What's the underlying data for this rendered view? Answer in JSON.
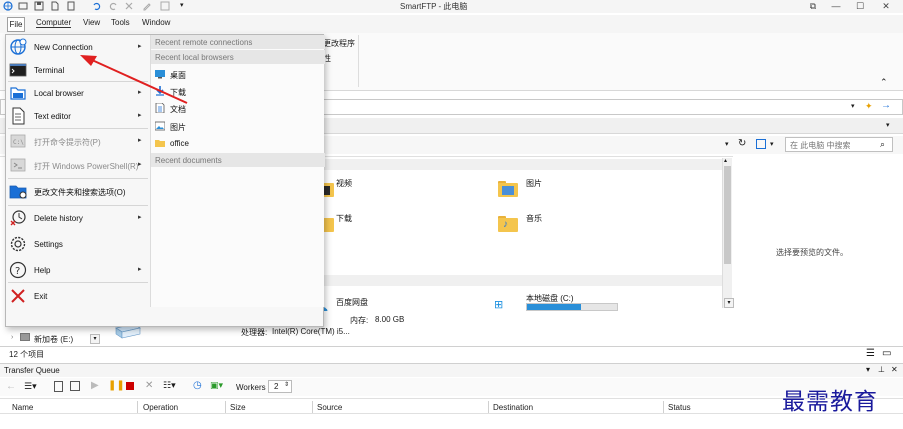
{
  "window": {
    "title": "SmartFTP - 此电脑"
  },
  "menubar": {
    "file": "File",
    "computer": "Computer",
    "view": "View",
    "tools": "Tools",
    "window": "Window"
  },
  "ribbon": {
    "fragment_1": "更改程序",
    "fragment_2": "性"
  },
  "search": {
    "placeholder": "在 此电脑 中搜索"
  },
  "file_menu": {
    "items": [
      {
        "label": "New Connection",
        "icon": "globe-icon",
        "submenu": true
      },
      {
        "label": "Terminal",
        "icon": "terminal-icon",
        "submenu": false
      },
      {
        "label": "Local browser",
        "icon": "local-browser-icon",
        "submenu": true
      },
      {
        "label": "Text editor",
        "icon": "text-editor-icon",
        "submenu": true
      },
      {
        "label": "打开命令提示符(P)",
        "icon": "cmd-icon",
        "submenu": true,
        "disabled": true
      },
      {
        "label": "打开 Windows PowerShell(R)",
        "icon": "powershell-icon",
        "submenu": true,
        "disabled": true
      },
      {
        "label": "更改文件夹和搜索选项(O)",
        "icon": "folder-options-icon",
        "submenu": false
      },
      {
        "label": "Delete history",
        "icon": "history-icon",
        "submenu": true
      },
      {
        "label": "Settings",
        "icon": "gear-icon",
        "submenu": false
      },
      {
        "label": "Help",
        "icon": "help-icon",
        "submenu": true
      },
      {
        "label": "Exit",
        "icon": "exit-icon",
        "submenu": false
      }
    ],
    "recent": {
      "remote_header": "Recent remote connections",
      "local_header": "Recent local browsers",
      "local_items": [
        {
          "label": "桌面",
          "icon": "desktop-icon"
        },
        {
          "label": "下载",
          "icon": "download-icon"
        },
        {
          "label": "文档",
          "icon": "document-icon"
        },
        {
          "label": "图片",
          "icon": "picture-icon"
        },
        {
          "label": "office",
          "icon": "folder-icon"
        }
      ],
      "documents_header": "Recent documents"
    }
  },
  "content": {
    "folders": [
      {
        "label": "视频",
        "icon": "video-folder-icon"
      },
      {
        "label": "图片",
        "icon": "picture-folder-icon"
      },
      {
        "label": "下载",
        "icon": "download-folder-icon"
      },
      {
        "label": "音乐",
        "icon": "music-folder-icon"
      }
    ],
    "drives": [
      {
        "label": "百度网盘",
        "icon": "baidu-netdisk-icon"
      },
      {
        "label": "本地磁盘 (C:)",
        "icon": "windows-drive-icon",
        "usage": 0.6
      }
    ],
    "sys": {
      "memory_label": "内存:",
      "memory_value": "8.00 GB",
      "cpu_label": "处理器:",
      "cpu_value": "Intel(R) Core(TM) i5..."
    },
    "tree_item": "新加卷 (E:)",
    "preview_text": "选择要预览的文件。"
  },
  "status": {
    "count": "12 个项目"
  },
  "transfer_queue": {
    "title": "Transfer Queue",
    "workers_label": "Workers",
    "workers_value": "2",
    "columns": [
      "Name",
      "Operation",
      "Size",
      "Source",
      "Destination",
      "Status"
    ]
  },
  "watermark": "最需教育",
  "colors": {
    "accent": "#1a6fd6",
    "arrow": "#e02020",
    "watermark": "#1a1a9c",
    "drive_bar": "#2a8fd8"
  }
}
